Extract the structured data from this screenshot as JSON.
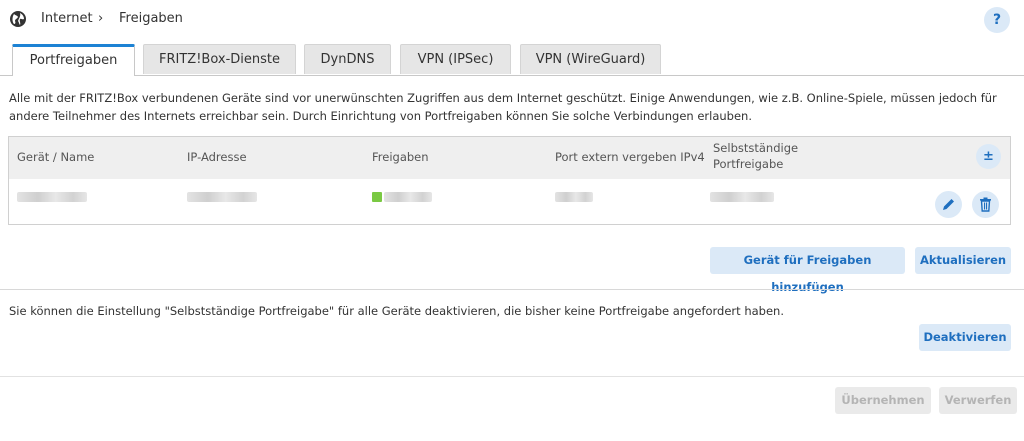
{
  "breadcrumb": {
    "section": "Internet",
    "separator": "›",
    "page": "Freigaben",
    "help": "?"
  },
  "tabs": [
    {
      "label": "Portfreigaben",
      "active": true
    },
    {
      "label": "FRITZ!Box-Dienste",
      "active": false
    },
    {
      "label": "DynDNS",
      "active": false
    },
    {
      "label": "VPN (IPSec)",
      "active": false
    },
    {
      "label": "VPN (WireGuard)",
      "active": false
    }
  ],
  "intro": "Alle mit der FRITZ!Box verbundenen Geräte sind vor unerwünschten Zugriffen aus dem Internet geschützt. Einige Anwendungen, wie z.B. Online-Spiele, müssen jedoch für andere Teilnehmer des Internets erreichbar sein. Durch Einrichtung von Portfreigaben können Sie solche Verbindungen erlauben.",
  "table": {
    "columns": [
      "Gerät / Name",
      "IP-Adresse",
      "Freigaben",
      "Port extern vergeben IPv4",
      "Selbstständige",
      "Portfreigabe"
    ],
    "add_column_icon": "±"
  },
  "buttons": {
    "add_device": "Gerät für Freigaben hinzufügen",
    "refresh": "Aktualisieren",
    "deactivate": "Deaktivieren",
    "apply": "Übernehmen",
    "discard": "Verwerfen"
  },
  "hint": "Sie können die Einstellung \"Selbstständige Portfreigabe\" für alle Geräte deaktivieren, die bisher keine Portfreigabe angefordert haben.",
  "colors": {
    "accent": "#1c82d4",
    "button_bg": "#dbe9f7",
    "button_text": "#1f6fbf",
    "status_green": "#7ac943"
  },
  "icons": {
    "globe": "globe-icon",
    "edit": "pencil-icon",
    "delete": "trash-icon"
  }
}
